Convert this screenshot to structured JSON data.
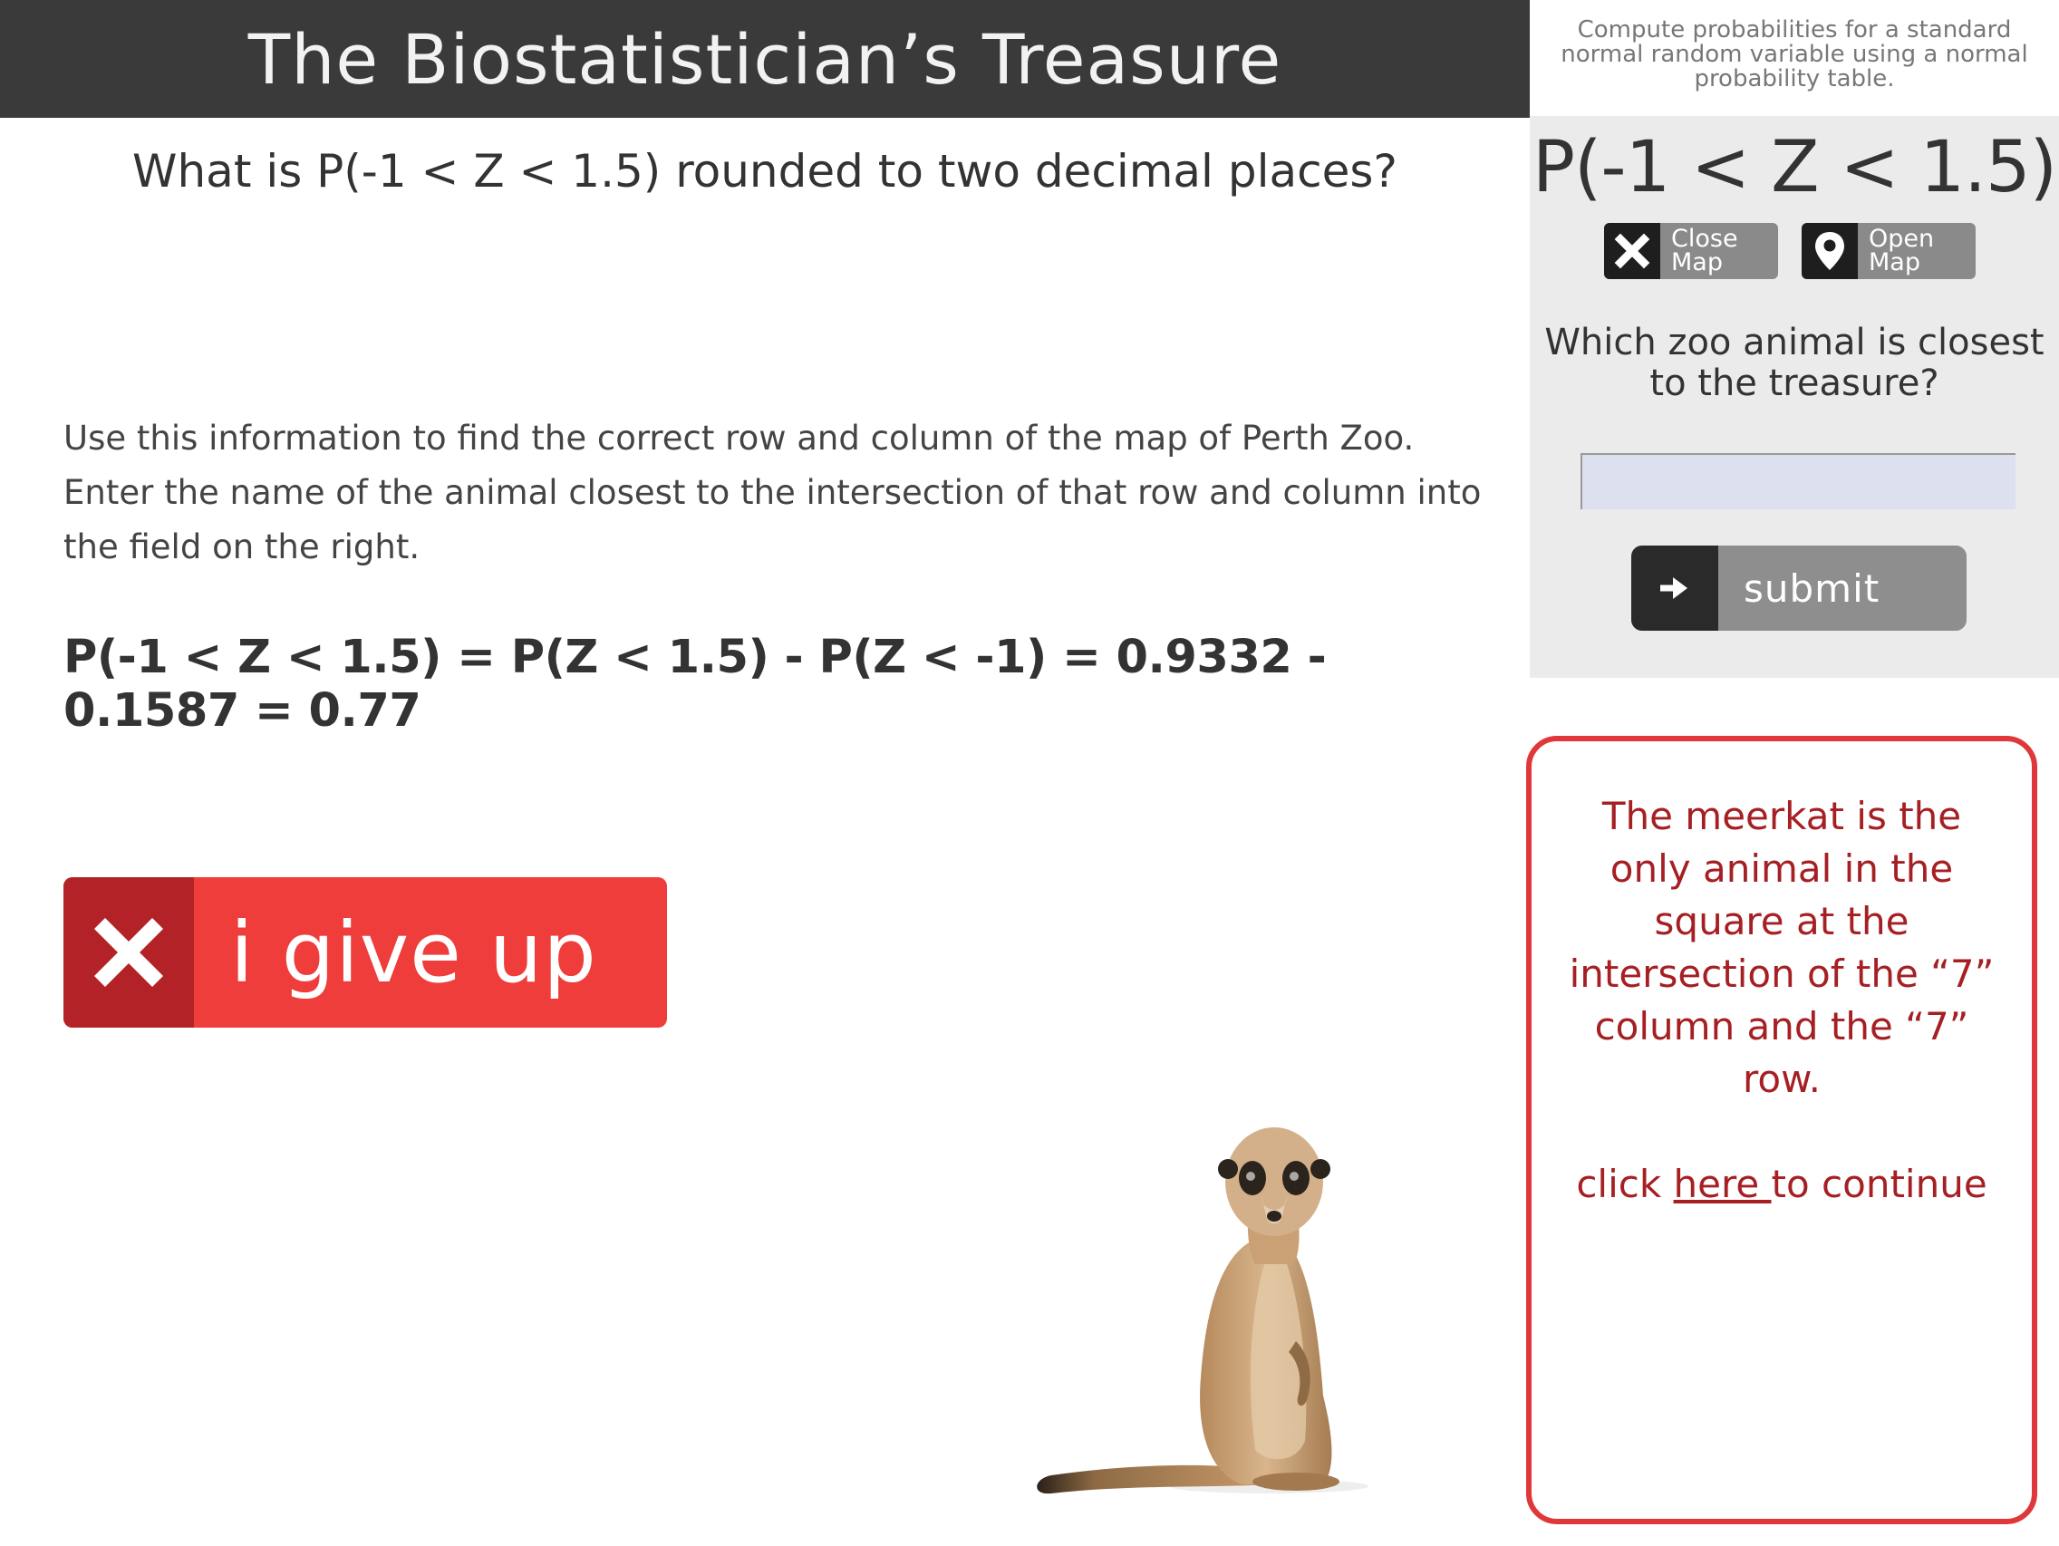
{
  "header": {
    "title": "The Biostatistician’s Treasure",
    "objective": "Compute probabilities for a standard normal random variable using a normal probability table."
  },
  "panel": {
    "expression": "P(-1 < Z < 1.5)",
    "close_map": {
      "line1": "Close",
      "line2": "Map",
      "icon": "close-icon"
    },
    "open_map": {
      "line1": "Open",
      "line2": "Map",
      "icon": "map-pin-icon"
    },
    "question": "Which zoo animal is closest to the treasure?",
    "answer": {
      "value": "",
      "placeholder": ""
    },
    "submit_label": "submit",
    "submit_icon": "arrow-right-icon"
  },
  "main": {
    "question": "What is P(-1 < Z < 1.5) rounded to two decimal places?",
    "instructions": "Use this information to find the correct row and column of the map of Perth Zoo. Enter the name of the animal closest to the intersection of that row and column into the field on the right.",
    "solution": "P(-1 < Z < 1.5) = P(Z < 1.5) - P(Z < -1) = 0.9332 - 0.1587 = 0.77",
    "give_up_label": "i give up",
    "give_up_icon": "close-icon"
  },
  "feedback": {
    "message": "The meerkat is the only animal in the square at the intersection of the “7” column and the “7” row.",
    "continue_prefix": "click ",
    "continue_link": "here ",
    "continue_suffix": "to continue"
  },
  "colors": {
    "header_bg": "#3a3a3a",
    "panel_bg": "#ebebeb",
    "give_up_red": "#ee3d3a",
    "give_up_dark_red": "#b22226",
    "feedback_border": "#e0383a",
    "feedback_text": "#a51f23",
    "input_bg": "#dde1ef"
  }
}
